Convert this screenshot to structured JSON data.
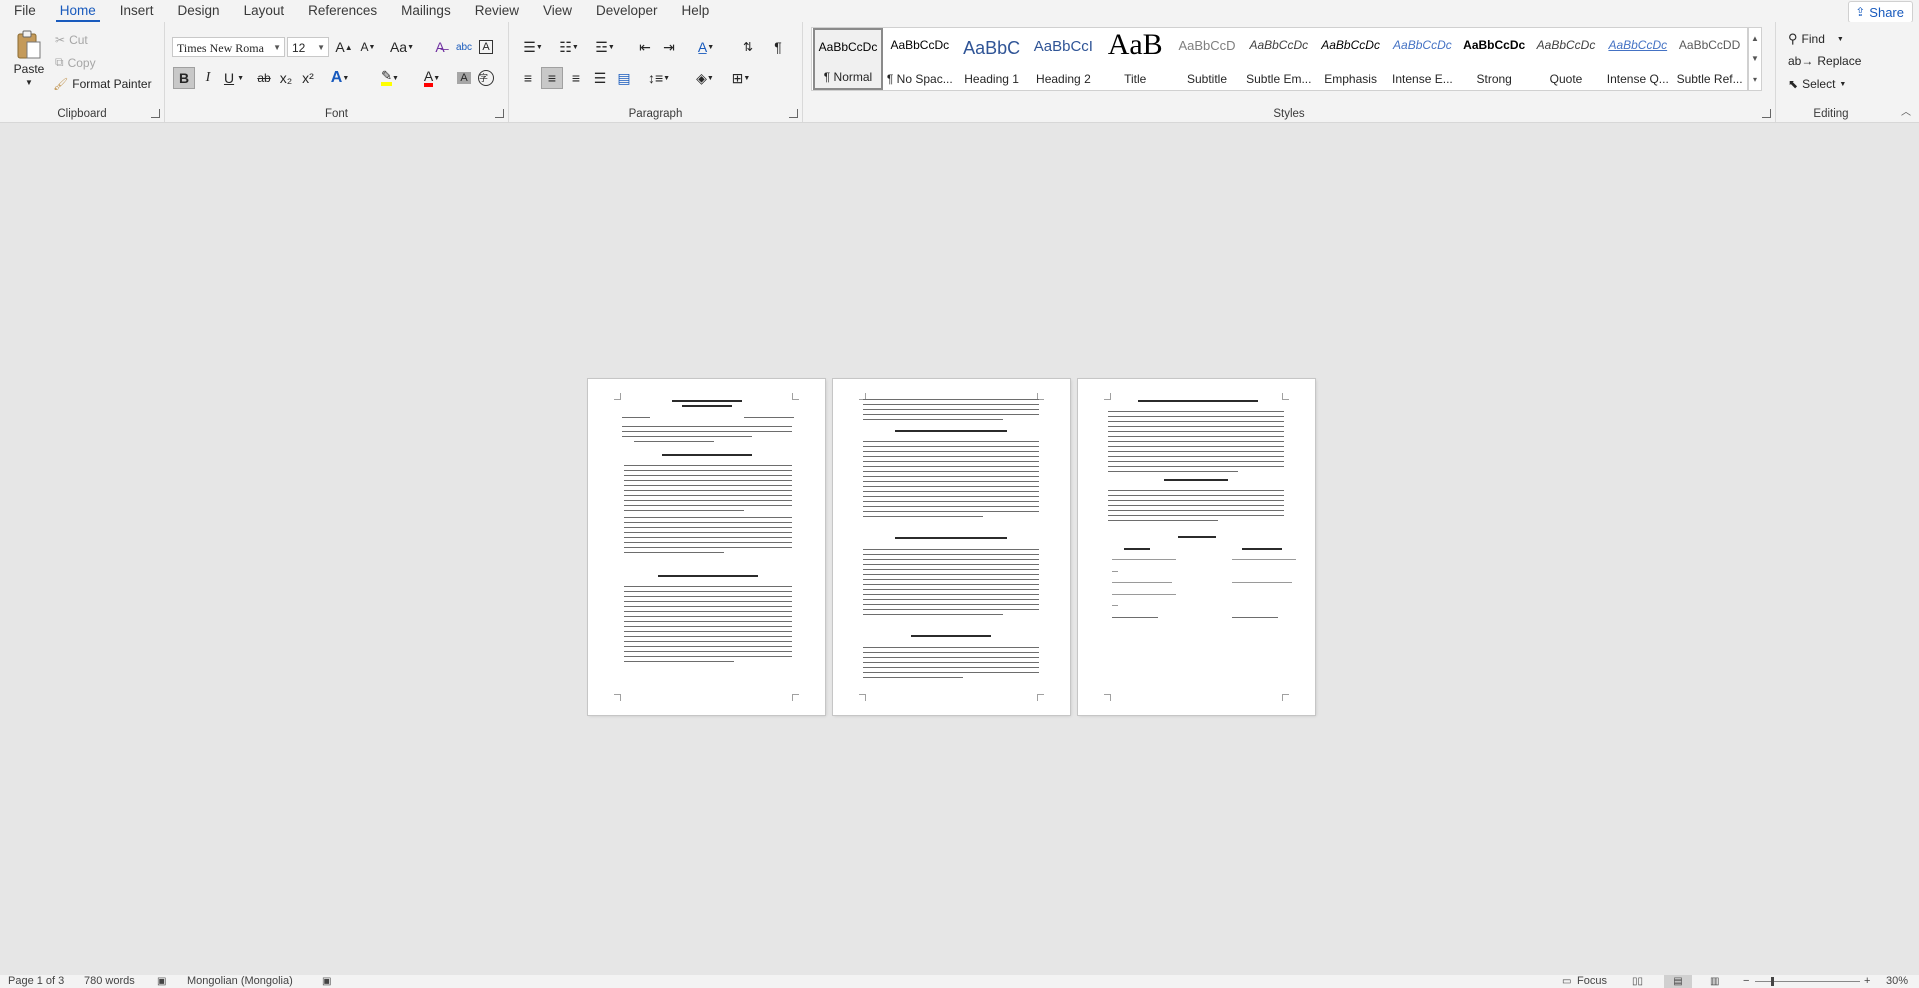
{
  "tabs": [
    "File",
    "Home",
    "Insert",
    "Design",
    "Layout",
    "References",
    "Mailings",
    "Review",
    "View",
    "Developer",
    "Help"
  ],
  "active_tab": "Home",
  "share_label": "Share",
  "clipboard": {
    "label": "Clipboard",
    "paste": "Paste",
    "cut": "Cut",
    "copy": "Copy",
    "format_painter": "Format Painter"
  },
  "font": {
    "label": "Font",
    "font_name": "Times New Roma",
    "font_size": "12",
    "bold": "B",
    "italic": "I",
    "underline": "U",
    "strike": "ab",
    "subscript": "x₂",
    "superscript": "x²",
    "grow": "A",
    "shrink": "A",
    "case": "Aa"
  },
  "paragraph": {
    "label": "Paragraph"
  },
  "styles": {
    "label": "Styles",
    "items": [
      {
        "sample": "AaBbCcDc",
        "name": "¶ Normal",
        "color": "#000000",
        "size": 12,
        "weight": "normal",
        "italic": false
      },
      {
        "sample": "AaBbCcDc",
        "name": "¶ No Spac...",
        "color": "#000000",
        "size": 12,
        "weight": "normal",
        "italic": false
      },
      {
        "sample": "AaBbC",
        "name": "Heading 1",
        "color": "#2f5496",
        "size": 18,
        "weight": "normal",
        "italic": false
      },
      {
        "sample": "AaBbCcI",
        "name": "Heading 2",
        "color": "#2f5496",
        "size": 15,
        "weight": "normal",
        "italic": false
      },
      {
        "sample": "AaB",
        "name": "Title",
        "color": "#000000",
        "size": 30,
        "weight": "normal",
        "italic": false
      },
      {
        "sample": "AaBbCcD",
        "name": "Subtitle",
        "color": "#7f7f7f",
        "size": 13,
        "weight": "normal",
        "italic": false
      },
      {
        "sample": "AaBbCcDc",
        "name": "Subtle Em...",
        "color": "#404040",
        "size": 12,
        "weight": "normal",
        "italic": true
      },
      {
        "sample": "AaBbCcDc",
        "name": "Emphasis",
        "color": "#000000",
        "size": 12,
        "weight": "normal",
        "italic": true
      },
      {
        "sample": "AaBbCcDc",
        "name": "Intense E...",
        "color": "#4472c4",
        "size": 12,
        "weight": "normal",
        "italic": true
      },
      {
        "sample": "AaBbCcDc",
        "name": "Strong",
        "color": "#000000",
        "size": 12,
        "weight": "bold",
        "italic": false
      },
      {
        "sample": "AaBbCcDc",
        "name": "Quote",
        "color": "#404040",
        "size": 12,
        "weight": "normal",
        "italic": true
      },
      {
        "sample": "AaBbCcDc",
        "name": "Intense Q...",
        "color": "#4472c4",
        "size": 12,
        "weight": "normal",
        "italic": true
      },
      {
        "sample": "AaBbCcDD",
        "name": "Subtle Ref...",
        "color": "#5a5a5a",
        "size": 12,
        "weight": "normal",
        "italic": false
      }
    ]
  },
  "editing": {
    "label": "Editing",
    "find": "Find",
    "replace": "Replace",
    "select": "Select"
  },
  "status": {
    "page": "Page 1 of 3",
    "words": "780 words",
    "language": "Mongolian (Mongolia)",
    "focus": "Focus",
    "zoom": "30%"
  },
  "colors": {
    "accent": "#185abd",
    "highlight": "#ffff00",
    "font_color": "#ff0000"
  }
}
